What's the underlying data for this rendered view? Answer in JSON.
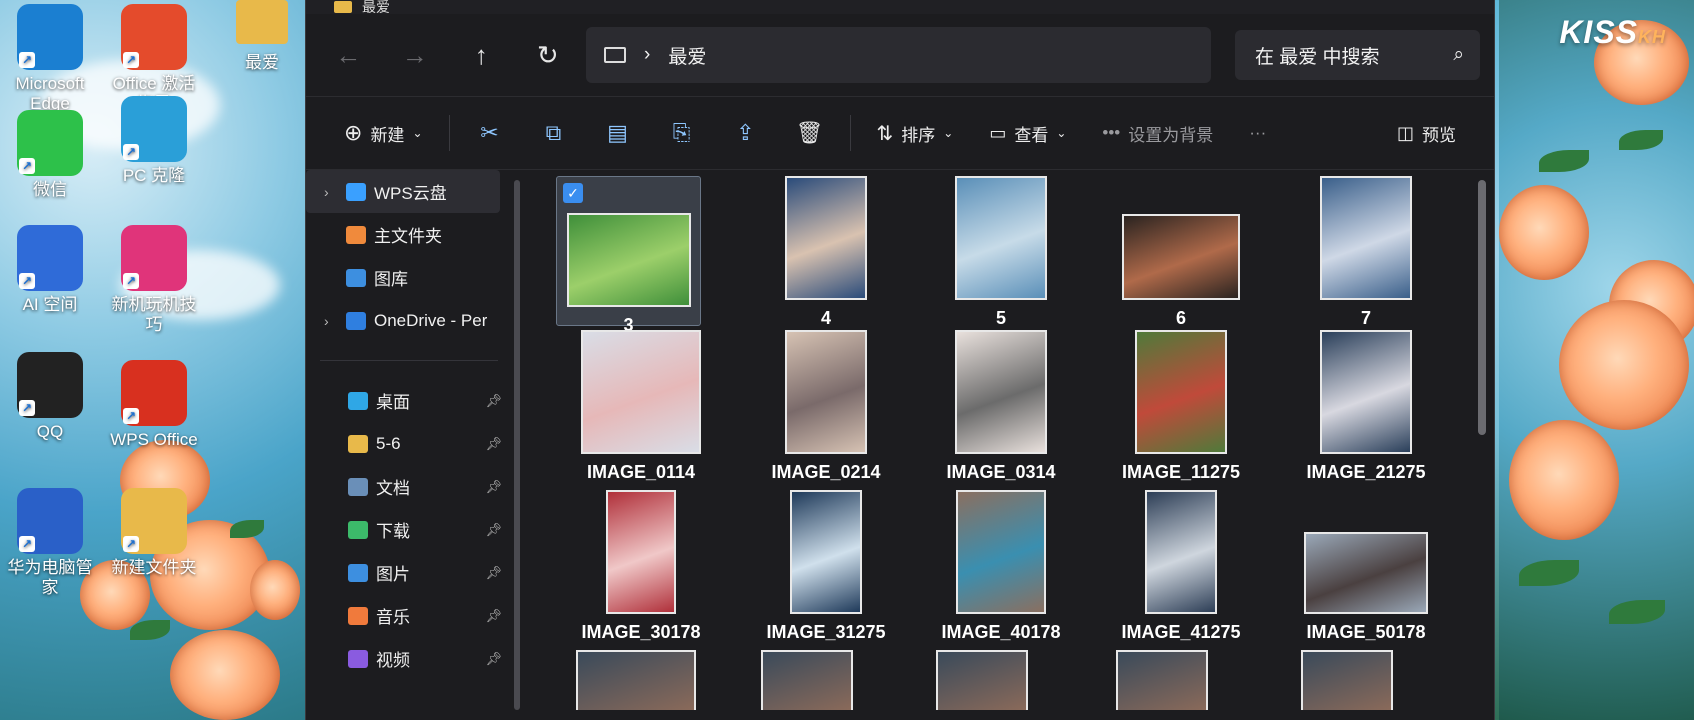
{
  "desktop": {
    "icons": [
      {
        "label": "Microsoft\nEdge",
        "icon": "edge-icon",
        "color": "#1b7fd1"
      },
      {
        "label": "Office 激活\n指导",
        "icon": "office-icon",
        "color": "#e44b2c"
      },
      {
        "label": "微信",
        "icon": "wechat-icon",
        "color": "#2dc14a"
      },
      {
        "label": "PC 克隆",
        "icon": "pc-clone-icon",
        "color": "#2a9fd8"
      },
      {
        "label": "AI 空间",
        "icon": "ai-space-icon",
        "color": "#2f6bd8"
      },
      {
        "label": "新机玩机技巧",
        "icon": "tips-icon",
        "color": "#e0347a"
      },
      {
        "label": "QQ",
        "icon": "qq-icon",
        "color": "#222222"
      },
      {
        "label": "WPS Office",
        "icon": "wps-icon",
        "color": "#d8301f"
      },
      {
        "label": "华为电脑管家",
        "icon": "pc-manager-icon",
        "color": "#2a60c8"
      },
      {
        "label": "新建文件夹",
        "icon": "folder-icon",
        "color": "#e8b94a"
      }
    ],
    "partial_icon_label": "最爱",
    "brand": {
      "main": "KISS",
      "sub": "KH"
    }
  },
  "explorer": {
    "window_title": "最爱",
    "nav": {
      "back": "←",
      "forward": "→",
      "up": "↑",
      "refresh": "↻"
    },
    "address": {
      "separator": "›",
      "location": "最爱"
    },
    "search": {
      "placeholder": "在 最爱 中搜索",
      "icon": "search-icon"
    },
    "toolbar": {
      "new_label": "新建",
      "sort_label": "排序",
      "view_label": "查看",
      "more_label": "设置为背景",
      "preview_label": "预览",
      "accent_color": "#8fc7ff"
    },
    "sidebar": {
      "top_items": [
        {
          "label": "WPS云盘",
          "icon": "wps-cloud-icon",
          "expandable": true,
          "selected": true
        },
        {
          "label": "主文件夹",
          "icon": "home-icon",
          "expandable": false
        },
        {
          "label": "图库",
          "icon": "gallery-icon",
          "expandable": false
        },
        {
          "label": "OneDrive - Per",
          "icon": "onedrive-icon",
          "expandable": true
        }
      ],
      "pinned_items": [
        {
          "label": "桌面",
          "icon": "desktop-icon"
        },
        {
          "label": "5-6",
          "icon": "folder-icon"
        },
        {
          "label": "文档",
          "icon": "documents-icon"
        },
        {
          "label": "下载",
          "icon": "download-icon"
        },
        {
          "label": "图片",
          "icon": "pictures-icon"
        },
        {
          "label": "音乐",
          "icon": "music-icon"
        },
        {
          "label": "视频",
          "icon": "video-icon"
        }
      ]
    },
    "files": [
      {
        "name": "3",
        "selected": true
      },
      {
        "name": "4"
      },
      {
        "name": "5"
      },
      {
        "name": "6"
      },
      {
        "name": "7"
      },
      {
        "name": "IMAGE_0114"
      },
      {
        "name": "IMAGE_0214"
      },
      {
        "name": "IMAGE_0314"
      },
      {
        "name": "IMAGE_11275"
      },
      {
        "name": "IMAGE_21275"
      },
      {
        "name": "IMAGE_30178"
      },
      {
        "name": "IMAGE_31275"
      },
      {
        "name": "IMAGE_40178"
      },
      {
        "name": "IMAGE_41275"
      },
      {
        "name": "IMAGE_50178"
      }
    ]
  }
}
